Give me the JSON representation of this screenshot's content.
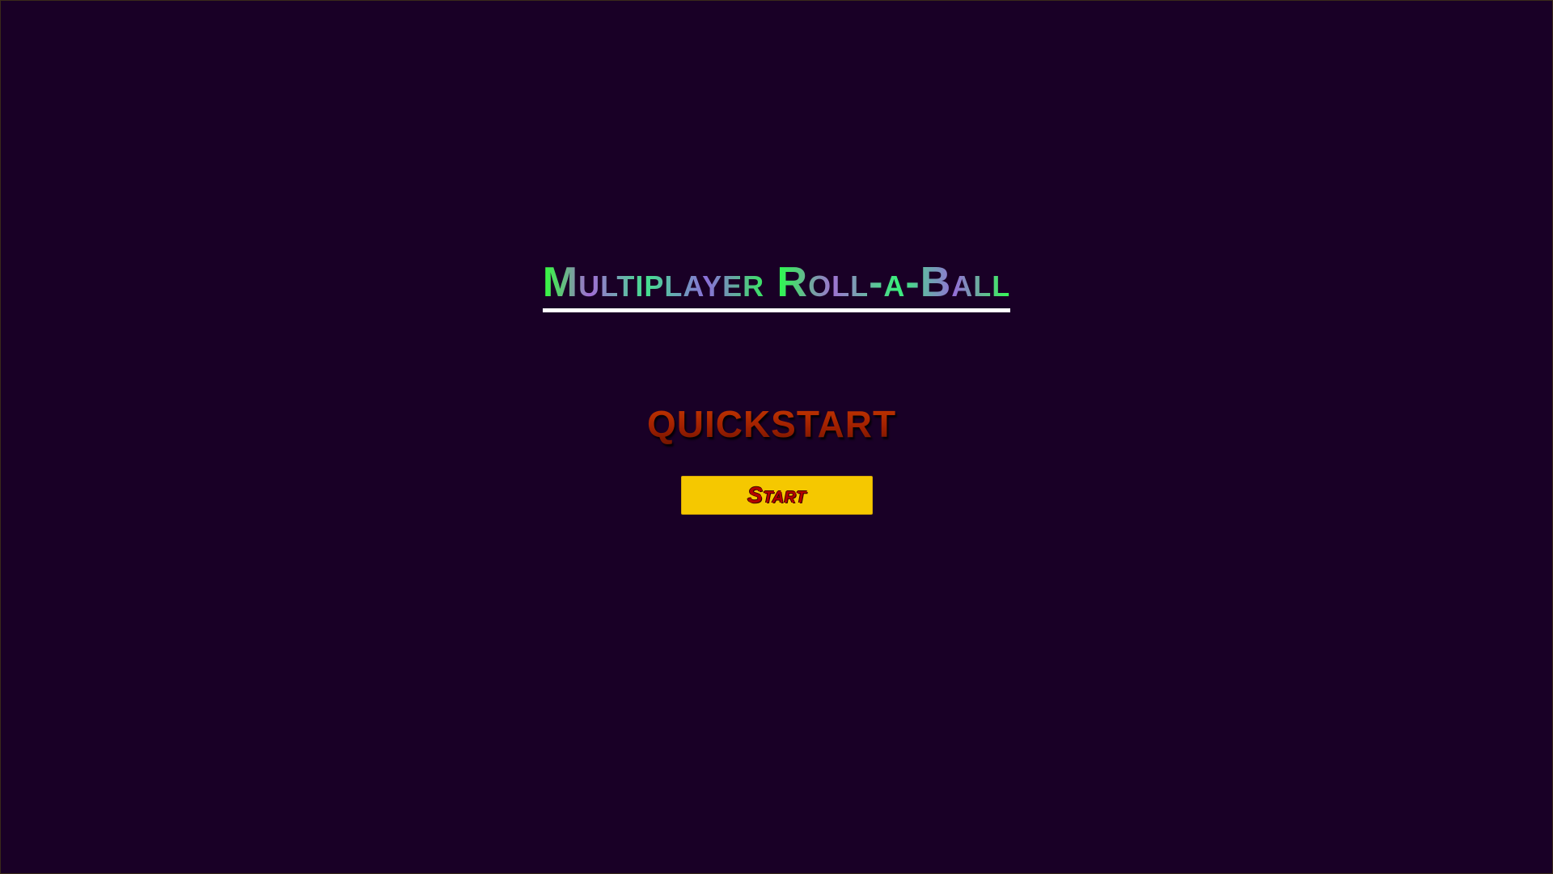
{
  "menu": {
    "title": "Multiplayer Roll-a-Ball",
    "section_heading": "QUICKSTART",
    "start_button_label": "Start"
  },
  "colors": {
    "background": "#190026",
    "button": "#f5c800",
    "button_text": "#b40000",
    "heading": "#b02a05",
    "title_green": "#31ff3a",
    "title_purple": "#a26bd6",
    "title_underline": "#ffffff"
  }
}
